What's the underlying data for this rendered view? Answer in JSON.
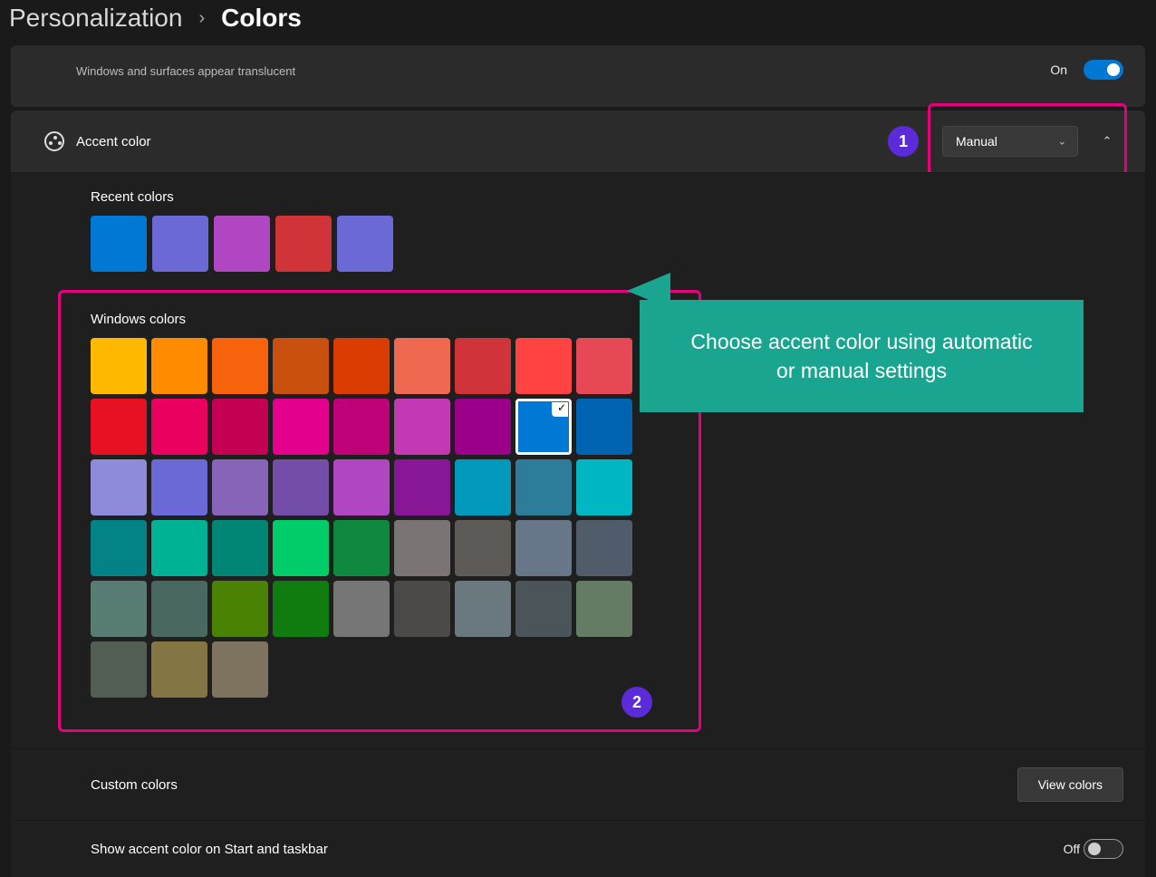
{
  "breadcrumb": {
    "parent": "Personalization",
    "current": "Colors"
  },
  "transparency": {
    "subtitle": "Windows and surfaces appear translucent",
    "state_label": "On"
  },
  "accent": {
    "title": "Accent color",
    "mode_value": "Manual",
    "recent_label": "Recent colors",
    "windows_label": "Windows colors",
    "recent_colors": [
      "#0078d4",
      "#6b69d6",
      "#b146c2",
      "#d13438",
      "#6b69d6"
    ],
    "windows_colors": [
      "#ffb900",
      "#ff8c00",
      "#f7630c",
      "#ca5010",
      "#da3b01",
      "#ef6950",
      "#d13438",
      "#ff4343",
      "#e74856",
      "#e81123",
      "#ea005e",
      "#c30052",
      "#e3008c",
      "#bf0077",
      "#c239b3",
      "#9a0089",
      "#0078d4",
      "#0063b1",
      "#8e8cd8",
      "#6b69d6",
      "#8764b8",
      "#744da9",
      "#b146c2",
      "#881798",
      "#0099bc",
      "#2d7d9a",
      "#00b7c3",
      "#038387",
      "#00b294",
      "#018574",
      "#00cc6a",
      "#10893e",
      "#7a7574",
      "#5d5a58",
      "#68768a",
      "#515c6b",
      "#567c73",
      "#486860",
      "#498205",
      "#107c10",
      "#767676",
      "#4c4a48",
      "#69797e",
      "#4a5459",
      "#647c64",
      "#525e54",
      "#847545",
      "#7e735f"
    ],
    "selected_index": 16
  },
  "custom": {
    "label": "Custom colors",
    "button": "View colors"
  },
  "show_start": {
    "label": "Show accent color on Start and taskbar",
    "state_label": "Off"
  },
  "annotations": {
    "badge1": "1",
    "badge2": "2",
    "callout": "Choose accent color using automatic or manual settings"
  }
}
